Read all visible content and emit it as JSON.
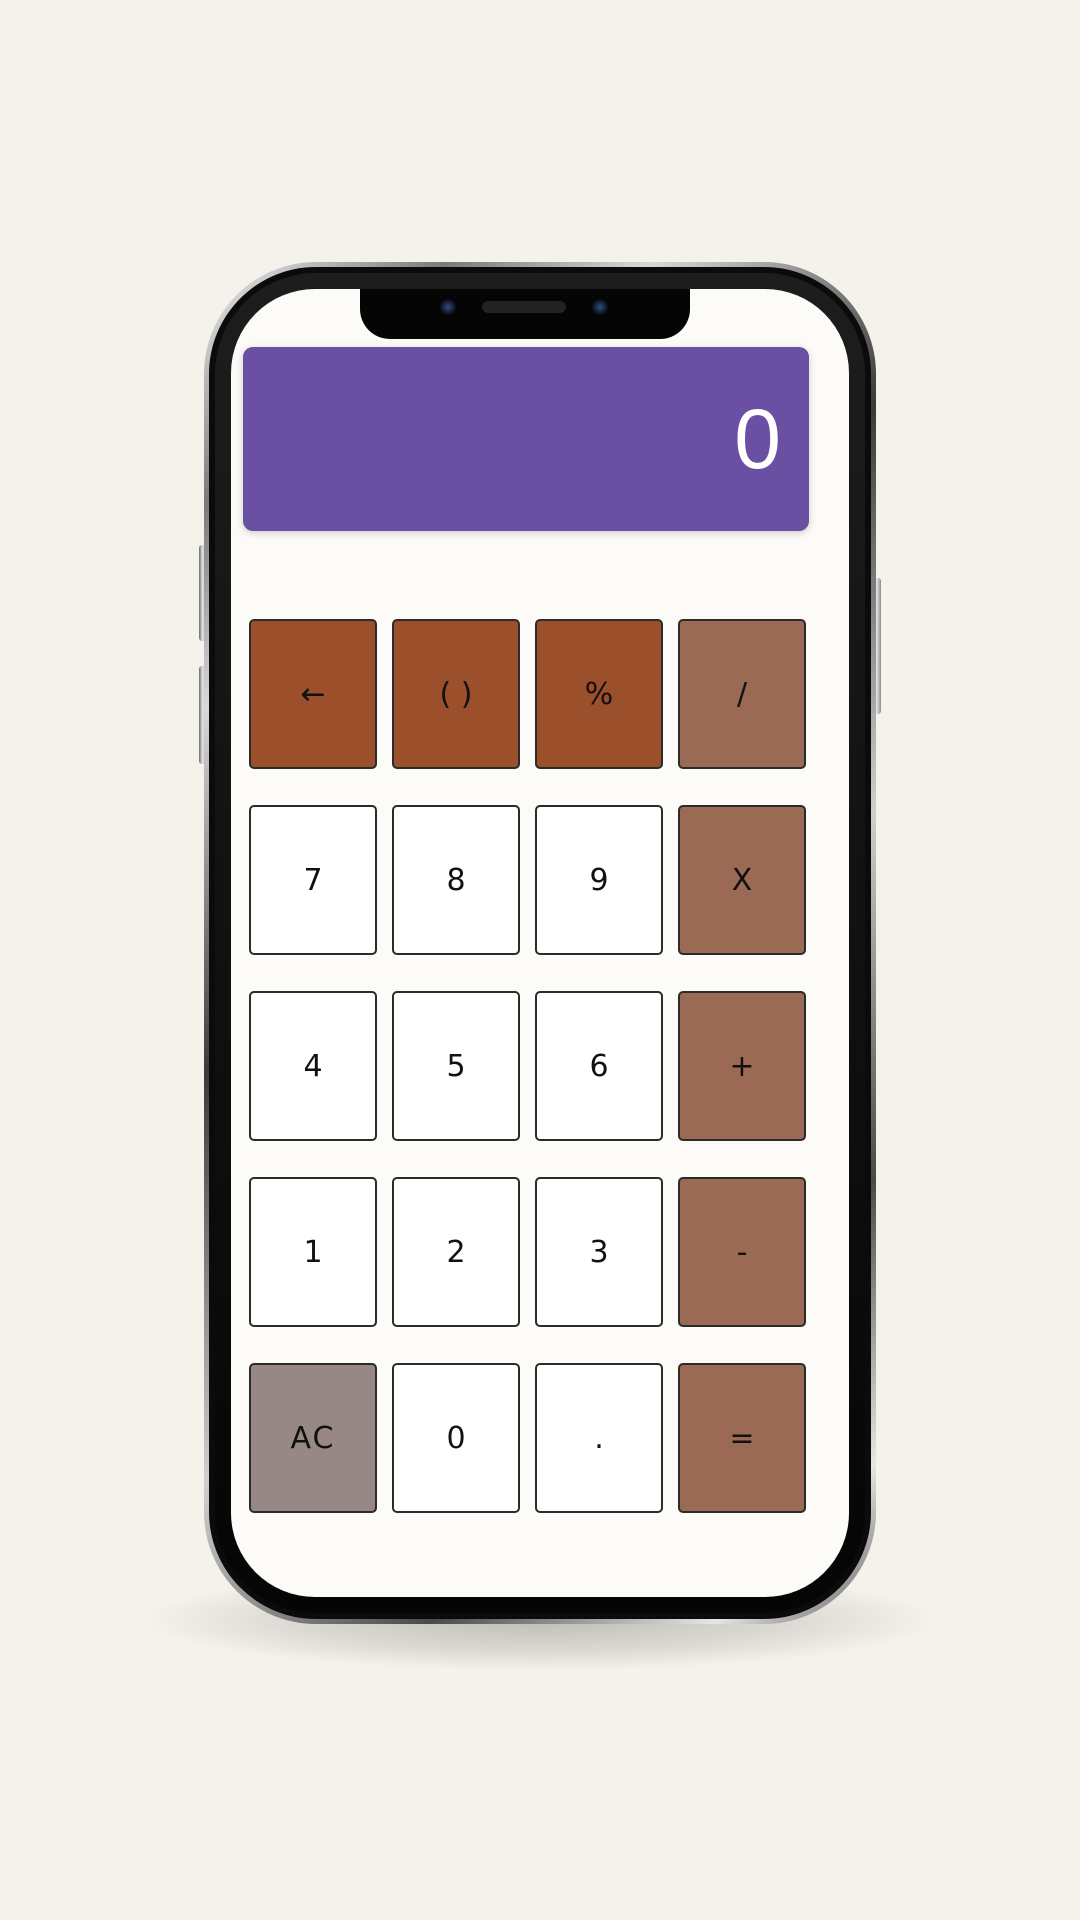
{
  "display": {
    "value": "0"
  },
  "keys": [
    {
      "label": "←",
      "type": "func",
      "name": "backspace-key"
    },
    {
      "label": "( )",
      "type": "func",
      "name": "parentheses-key"
    },
    {
      "label": "%",
      "type": "func",
      "name": "percent-key"
    },
    {
      "label": "/",
      "type": "op",
      "name": "divide-key"
    },
    {
      "label": "7",
      "type": "num",
      "name": "digit-7-key"
    },
    {
      "label": "8",
      "type": "num",
      "name": "digit-8-key"
    },
    {
      "label": "9",
      "type": "num",
      "name": "digit-9-key"
    },
    {
      "label": "X",
      "type": "op",
      "name": "multiply-key"
    },
    {
      "label": "4",
      "type": "num",
      "name": "digit-4-key"
    },
    {
      "label": "5",
      "type": "num",
      "name": "digit-5-key"
    },
    {
      "label": "6",
      "type": "num",
      "name": "digit-6-key"
    },
    {
      "label": "+",
      "type": "op",
      "name": "add-key"
    },
    {
      "label": "1",
      "type": "num",
      "name": "digit-1-key"
    },
    {
      "label": "2",
      "type": "num",
      "name": "digit-2-key"
    },
    {
      "label": "3",
      "type": "num",
      "name": "digit-3-key"
    },
    {
      "label": "-",
      "type": "op",
      "name": "subtract-key"
    },
    {
      "label": "AC",
      "type": "clear",
      "name": "all-clear-key"
    },
    {
      "label": "0",
      "type": "num",
      "name": "digit-0-key"
    },
    {
      "label": ".",
      "type": "num",
      "name": "decimal-key"
    },
    {
      "label": "=",
      "type": "op",
      "name": "equals-key"
    }
  ],
  "colors": {
    "display_background": "#6950a3",
    "function_key": "#9b4f2a",
    "operator_key": "#9b6a55",
    "number_key": "#ffffff",
    "clear_key": "#978785",
    "page_background": "#f5f2ec"
  }
}
